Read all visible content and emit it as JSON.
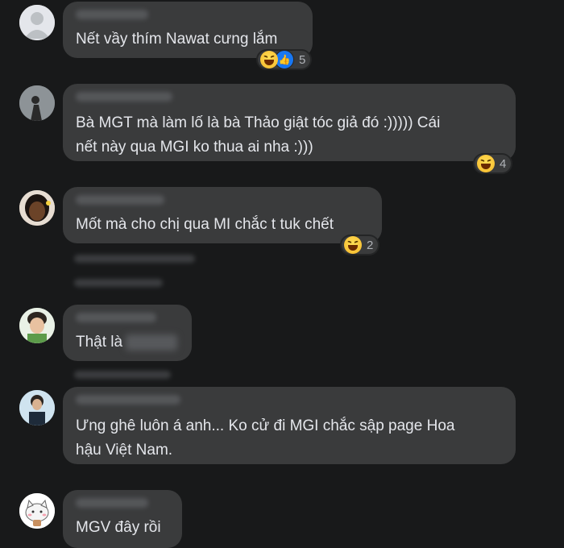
{
  "comments": [
    {
      "text": "Nết vầy thím Nawat cưng lắm",
      "reaction_count": "5"
    },
    {
      "line1": "Bà MGT mà làm lố là bà Thảo giật tóc giả đó :))))) Cái",
      "line2": "nết này qua MGI ko thua ai nha :)))",
      "reaction_count": "4"
    },
    {
      "text": "Mốt mà cho chị qua MI chắc t tuk chết",
      "reaction_count": "2"
    },
    {
      "text": "Thật là"
    },
    {
      "line1": "Ưng ghê luôn á anh... Ko cử đi MGI chắc sập page Hoa",
      "line2": "hậu Việt Nam."
    },
    {
      "text": "MGV đây rồi"
    }
  ],
  "icons": {
    "haha": "haha-emoji-icon",
    "like": "like-thumb-icon"
  },
  "colors": {
    "background": "#18191a",
    "bubble": "#3a3b3c",
    "text": "#e4e6eb",
    "like": "#1877f2"
  }
}
